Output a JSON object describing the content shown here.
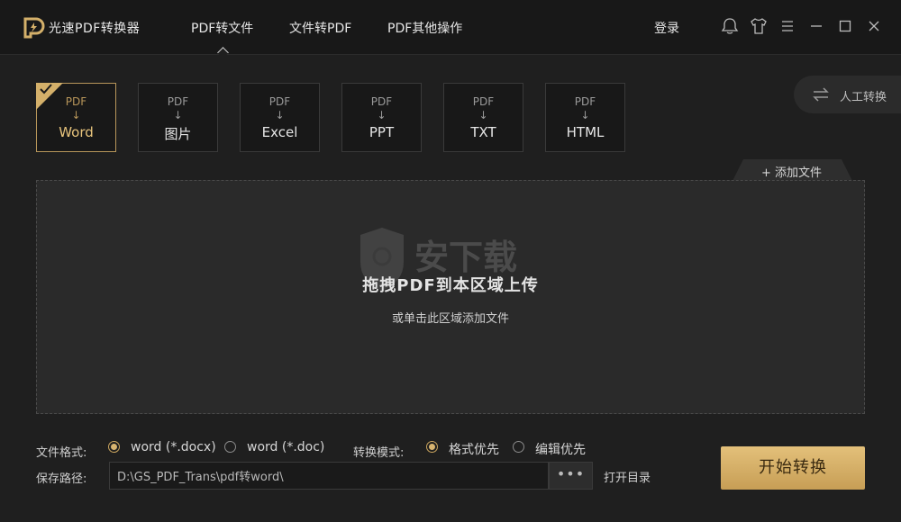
{
  "app": {
    "title": "光速PDF转换器",
    "nav": [
      "PDF转文件",
      "文件转PDF",
      "PDF其他操作"
    ],
    "active_nav": 0,
    "login": "登录",
    "window_icons": [
      "feedback-icon",
      "skin-icon",
      "menu-icon",
      "minimize-icon",
      "maximize-icon",
      "close-icon"
    ]
  },
  "formats": [
    {
      "top": "PDF",
      "arrow": "↓",
      "name": "Word",
      "selected": true
    },
    {
      "top": "PDF",
      "arrow": "↓",
      "name": "图片",
      "selected": false
    },
    {
      "top": "PDF",
      "arrow": "↓",
      "name": "Excel",
      "selected": false
    },
    {
      "top": "PDF",
      "arrow": "↓",
      "name": "PPT",
      "selected": false
    },
    {
      "top": "PDF",
      "arrow": "↓",
      "name": "TXT",
      "selected": false
    },
    {
      "top": "PDF",
      "arrow": "↓",
      "name": "HTML",
      "selected": false
    }
  ],
  "manual": {
    "label": "人工转换",
    "icon": "swap-icon"
  },
  "add_file": {
    "label": "添加文件",
    "icon": "plus-icon"
  },
  "dropzone": {
    "main_text": "拖拽PDF到本区域上传",
    "sub_text": "或单击此区域添加文件",
    "watermark_text": "安下载"
  },
  "options": {
    "format_label": "文件格式:",
    "format_options": [
      "word (*.docx)",
      "word (*.doc)"
    ],
    "format_selected": 0,
    "mode_label": "转换模式:",
    "mode_options": [
      "格式优先",
      "编辑优先"
    ],
    "mode_selected": 0,
    "save_label": "保存路径:",
    "save_path": "D:\\GS_PDF_Trans\\pdf转word\\",
    "browse_label": "•••",
    "open_dir": "打开目录"
  },
  "start_button": "开始转换",
  "colors": {
    "accent": "#d4b06a",
    "background": "#1f1f1f",
    "titlebar": "#181818",
    "dropzone": "#2a2a2a"
  }
}
